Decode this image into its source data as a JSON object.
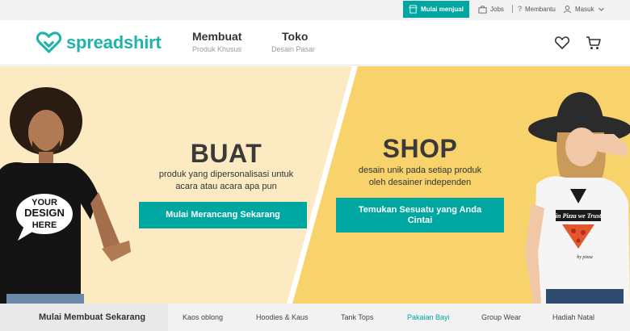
{
  "topbar": {
    "sell_label": "Mulai menjual",
    "jobs_label": "Jobs",
    "help_label": "Membantu",
    "login_label": "Masuk"
  },
  "header": {
    "logo_text": "spreadshirt",
    "nav": [
      {
        "title": "Membuat",
        "subtitle": "Produk Khusus"
      },
      {
        "title": "Toko",
        "subtitle": "Desain Pasar"
      }
    ]
  },
  "hero": {
    "create": {
      "title": "BUAT",
      "text_line1": "produk yang dipersonalisasi untuk",
      "text_line2": "acara atau acara apa pun",
      "button": "Mulai Merancang Sekarang"
    },
    "shop": {
      "title": "SHOP",
      "text_line1": "desain unik pada setiap produk",
      "text_line2": "oleh desainer independen",
      "button_line1": "Temukan Sesuatu yang Anda",
      "button_line2": "Cintai"
    },
    "shirt_left_text": [
      "YOUR",
      "DESIGN",
      "HERE"
    ],
    "shirt_right_text": [
      "in Pizza we Trust",
      "by pizza"
    ]
  },
  "categories": {
    "first": "Mulai Membuat Sekarang",
    "items": [
      "Kaos oblong",
      "Hoodies & Kaus",
      "Tank Tops",
      "Pakaian Bayi",
      "Group Wear",
      "Hadiah Natal"
    ],
    "active_index": 3
  },
  "colors": {
    "accent": "#00a7a0",
    "hero_left": "#fcebc2",
    "hero_right": "#f8d36b"
  }
}
